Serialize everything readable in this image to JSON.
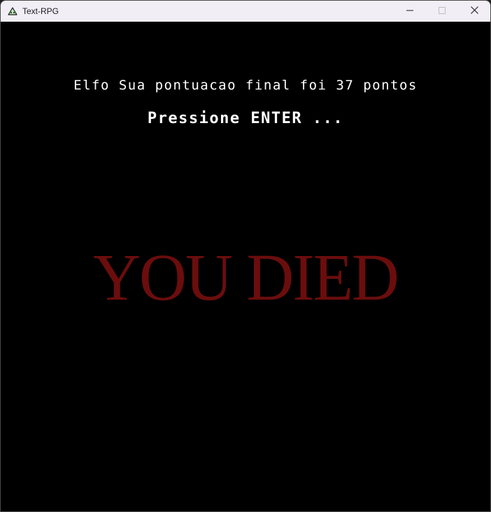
{
  "window": {
    "title": "Text-RPG",
    "icon": "app-icon",
    "controls": [
      "minimize-icon",
      "maximize-icon",
      "close-icon"
    ]
  },
  "game": {
    "score_message": "Elfo Sua pontuacao final foi 37 pontos",
    "prompt": "Pressione ENTER ...",
    "death_banner": "YOU DIED",
    "colors": {
      "background": "#000000",
      "text": "#ffffff",
      "death_banner": "#6b0d0d"
    }
  }
}
